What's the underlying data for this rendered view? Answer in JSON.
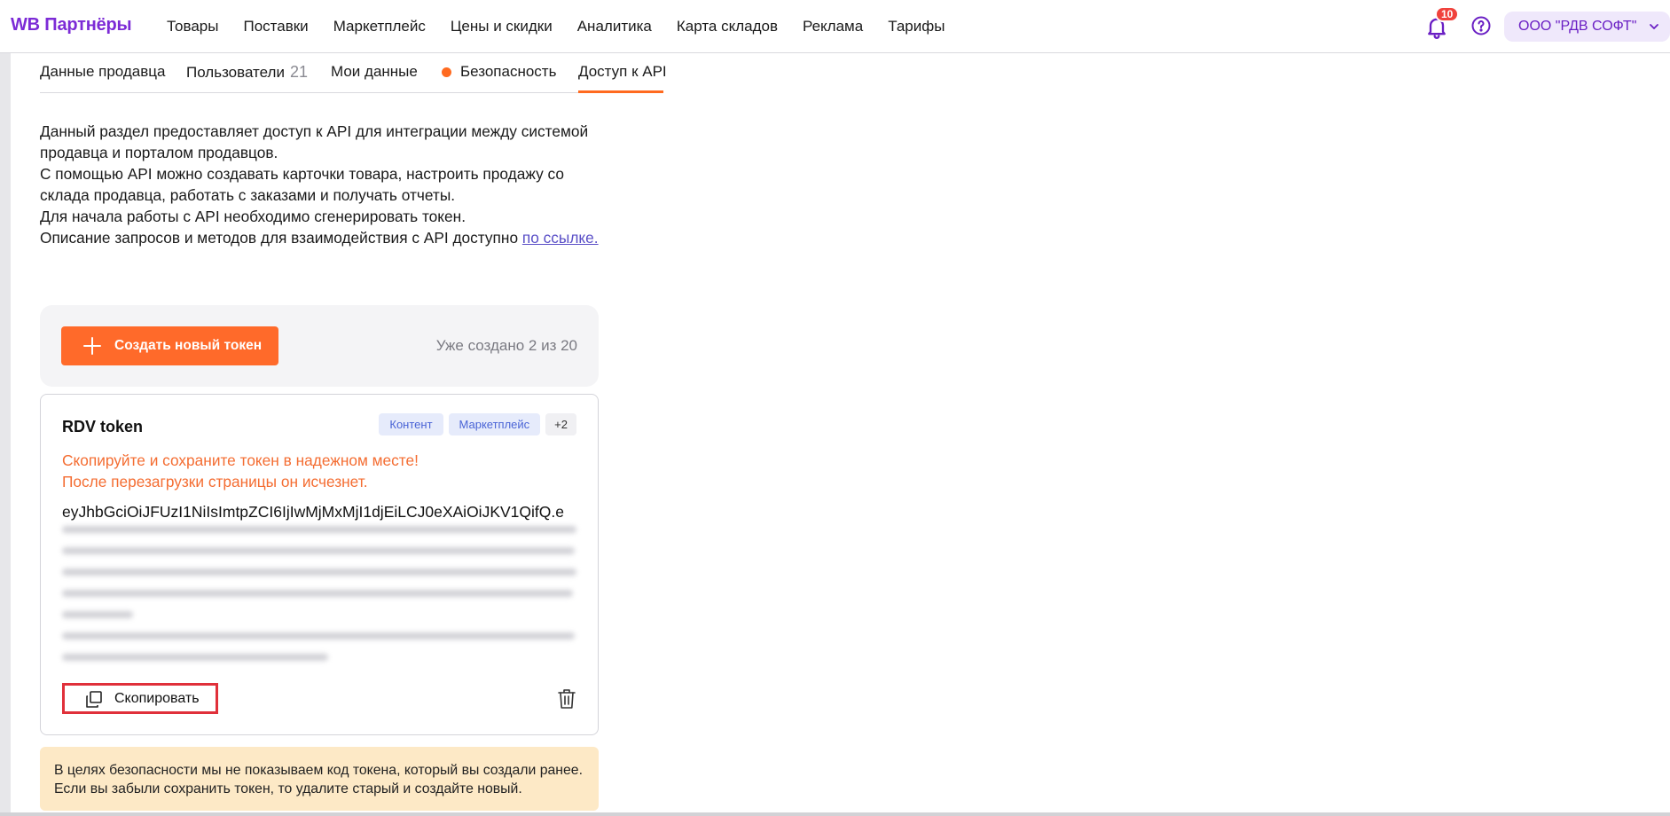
{
  "header": {
    "logo": "WB Партнёры",
    "nav": [
      "Товары",
      "Поставки",
      "Маркетплейс",
      "Цены и скидки",
      "Аналитика",
      "Карта складов",
      "Реклама",
      "Тарифы"
    ],
    "notifications_count": "10",
    "org_name": "ООО \"РДВ СОФТ\"",
    "icons": {
      "notifications": "bell-icon",
      "help": "question-circle-icon",
      "dropdown": "chevron-down-icon"
    }
  },
  "tabs": {
    "items": [
      {
        "label": "Данные продавца"
      },
      {
        "label": "Пользователи",
        "count": "21"
      },
      {
        "label": "Мои данные"
      },
      {
        "label": "Безопасность",
        "alert_dot": true
      },
      {
        "label": "Доступ к API",
        "active": true
      }
    ]
  },
  "description": {
    "line1": "Данный раздел предоставляет доступ к API для интеграции между системой продавца и порталом продавцов.",
    "line2": "С помощью API можно создавать карточки товара, настроить продажу со склада продавца, работать с заказами и получать отчеты.",
    "line3": "Для начала работы с API необходимо сгенерировать токен.",
    "line4": "Описание запросов и методов для взаимодействия с API доступно",
    "link": "по ссылке."
  },
  "create": {
    "button_label": "Создать новый токен",
    "created_count": "Уже создано 2 из 20"
  },
  "token": {
    "name": "RDV token",
    "tags": [
      "Контент",
      "Маркетплейс",
      "+2"
    ],
    "warning_line1": "Скопируйте и сохраните токен в надежном месте!",
    "warning_line2": "После перезагрузки страницы он исчезнет.",
    "value_visible": "eyJhbGciOiJFUzI1NiIsImtpZCI6IjIwMjMxMjI1djEiLCJ0eXAiOiJKV1QifQ.e",
    "copy_label": "Скопировать"
  },
  "notice": {
    "text": "В целях безопасности мы не показываем код токена, который вы создали ранее. Если вы забыли сохранить токен, то удалите старый и создайте новый."
  },
  "colors": {
    "brand_purple": "#7c2bd6",
    "accent_orange": "#ff6a2a",
    "warning_text": "#f46d32",
    "tag_blue": "#4a64d6",
    "notice_bg": "#fde9c6",
    "badge_red": "#f0423c"
  }
}
